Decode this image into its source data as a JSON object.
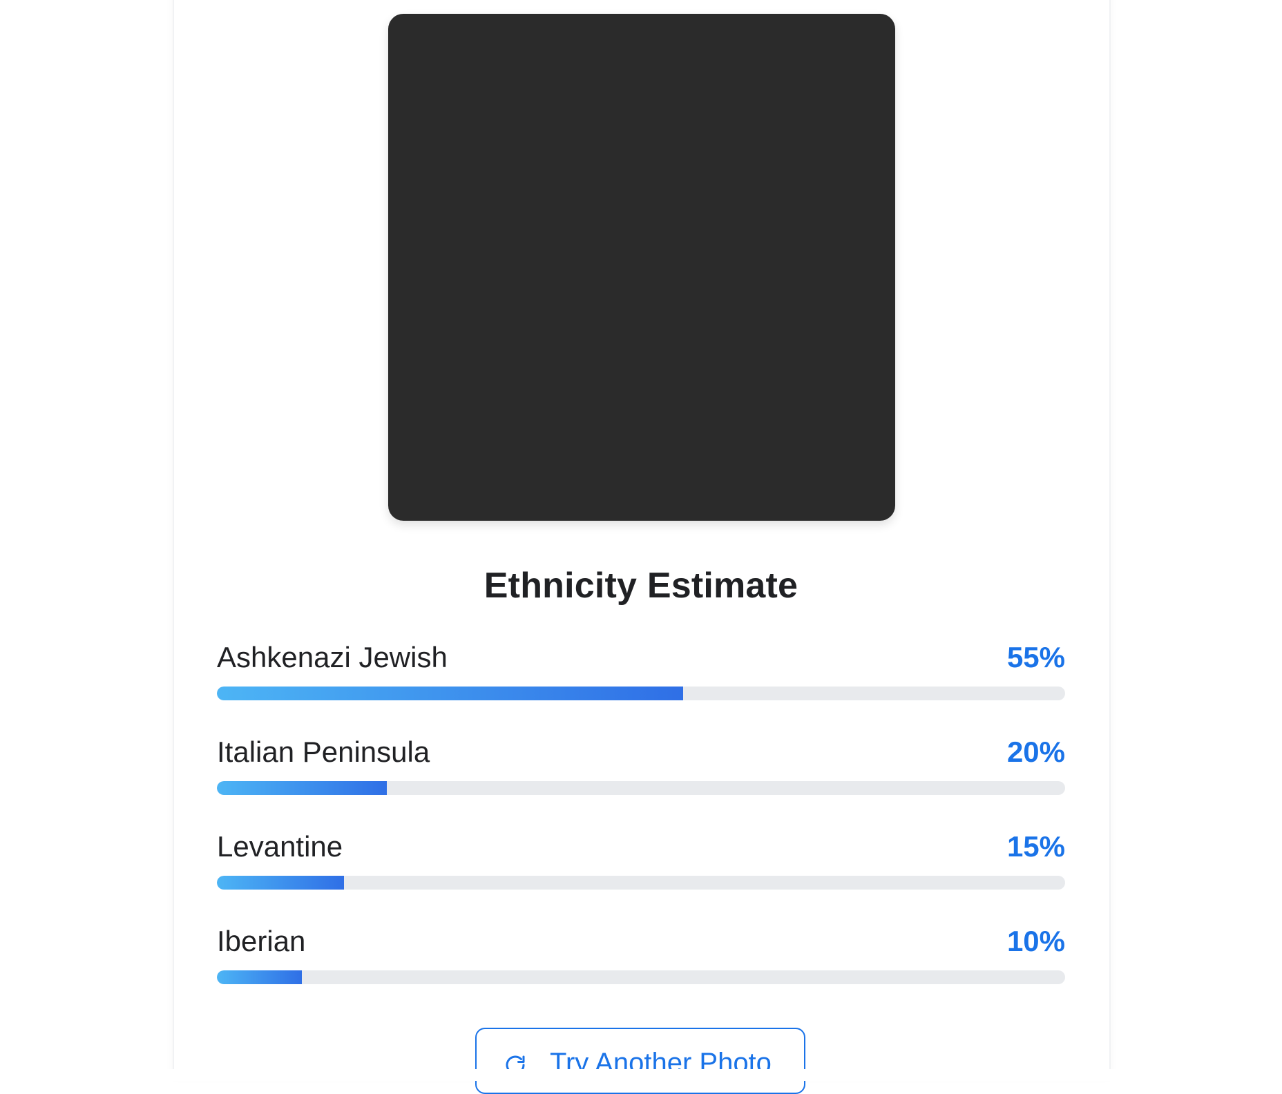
{
  "title": "Ethnicity Estimate",
  "results": [
    {
      "label": "Ashkenazi Jewish",
      "percent_text": "55%",
      "value": 55
    },
    {
      "label": "Italian Peninsula",
      "percent_text": "20%",
      "value": 20
    },
    {
      "label": "Levantine",
      "percent_text": "15%",
      "value": 15
    },
    {
      "label": "Iberian",
      "percent_text": "10%",
      "value": 10
    }
  ],
  "retry_button": {
    "label": "Try Another Photo",
    "icon": "refresh-icon"
  },
  "colors": {
    "accent": "#1a73e8",
    "bar_start": "#4db5f5",
    "bar_end": "#2f6fe6",
    "track": "#e8eaed"
  }
}
